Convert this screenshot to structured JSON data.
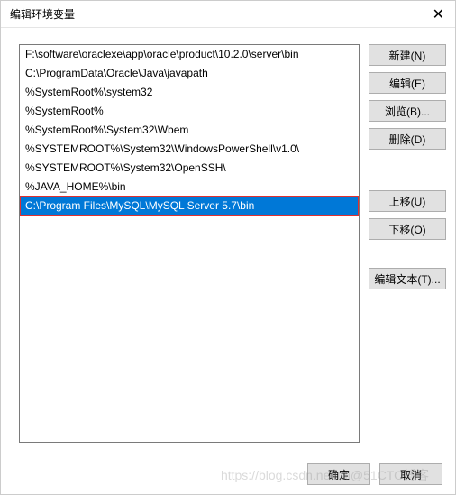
{
  "title": "编辑环境变量",
  "list_items": [
    "F:\\software\\oraclexe\\app\\oracle\\product\\10.2.0\\server\\bin",
    "C:\\ProgramData\\Oracle\\Java\\javapath",
    "%SystemRoot%\\system32",
    "%SystemRoot%",
    "%SystemRoot%\\System32\\Wbem",
    "%SYSTEMROOT%\\System32\\WindowsPowerShell\\v1.0\\",
    "%SYSTEMROOT%\\System32\\OpenSSH\\",
    "%JAVA_HOME%\\bin",
    "C:\\Program Files\\MySQL\\MySQL Server 5.7\\bin"
  ],
  "selected_index": 8,
  "buttons": {
    "new": "新建(N)",
    "edit": "编辑(E)",
    "browse": "浏览(B)...",
    "delete": "删除(D)",
    "move_up": "上移(U)",
    "move_down": "下移(O)",
    "edit_text": "编辑文本(T)...",
    "ok": "确定",
    "cancel": "取消"
  },
  "watermark": "https://blog.csdn.net/tai@51CTO博客"
}
